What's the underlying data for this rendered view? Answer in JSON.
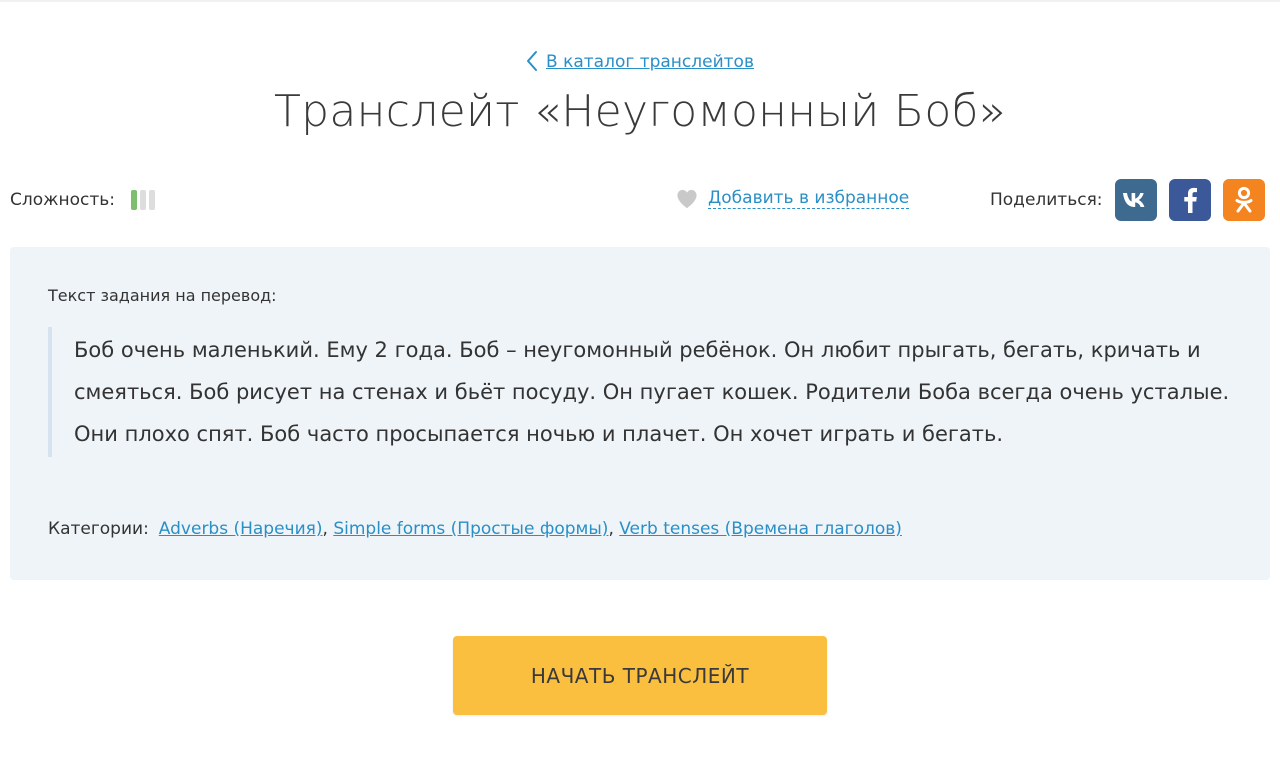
{
  "header": {
    "back_link": "В каталог транслейтов",
    "title": "Транслейт «Неугомонный Боб»"
  },
  "meta": {
    "difficulty_label": "Сложность:",
    "difficulty_level": 1,
    "difficulty_max": 3,
    "favorite_label": "Добавить в избранное",
    "share_label": "Поделиться:",
    "share_buttons": [
      {
        "name": "vk",
        "icon": "vk-icon",
        "color": "#3f6a8f"
      },
      {
        "name": "facebook",
        "icon": "facebook-icon",
        "color": "#3b5998"
      },
      {
        "name": "odnoklassniki",
        "icon": "odnoklassniki-icon",
        "color": "#f48420"
      }
    ]
  },
  "task": {
    "label": "Текст задания на перевод:",
    "text": "Боб очень маленький. Ему 2 года. Боб – неугомонный ребёнок. Он любит прыгать, бегать, кричать и смеяться. Боб рисует на стенах и бьёт посуду. Он пугает кошек. Родители Боба всегда очень усталые. Они плохо спят. Боб часто просыпается ночью и плачет. Он хочет играть и бегать.",
    "categories_label": "Категории:",
    "categories": [
      "Adverbs (Наречия)",
      "Simple forms (Простые формы)",
      "Verb tenses (Времена глаголов)"
    ]
  },
  "actions": {
    "start_label": "НАЧАТЬ ТРАНСЛЕЙТ"
  },
  "colors": {
    "link": "#2a8fc7",
    "button": "#fbbf3f",
    "panel": "#eff4f8",
    "difficulty_on": "#7cbf6e"
  }
}
